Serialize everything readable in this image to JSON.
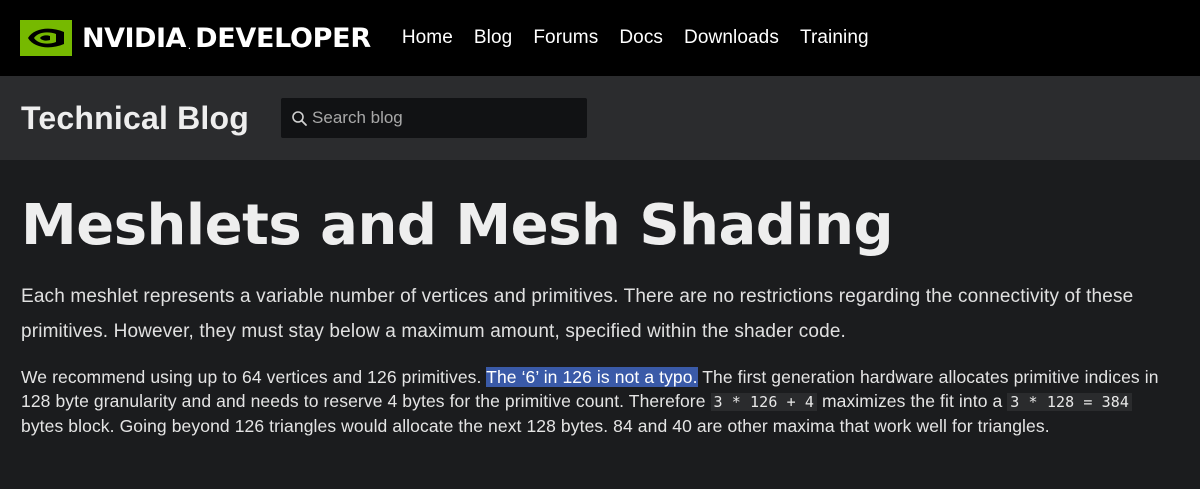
{
  "brand": {
    "logo_icon": "nvidia-eye-logo",
    "name": "NVIDIA",
    "dot": ".",
    "suffix": "DEVELOPER",
    "accent_color": "#76b900"
  },
  "nav": {
    "items": [
      {
        "label": "Home"
      },
      {
        "label": "Blog"
      },
      {
        "label": "Forums"
      },
      {
        "label": "Docs"
      },
      {
        "label": "Downloads"
      },
      {
        "label": "Training"
      }
    ]
  },
  "subheader": {
    "title": "Technical Blog",
    "search": {
      "icon": "search-icon",
      "placeholder": "Search blog",
      "value": ""
    }
  },
  "article": {
    "title": "Meshlets and Mesh Shading",
    "para1": "Each meshlet represents a variable number of vertices and primitives. There are no restrictions regarding the connectivity of these primitives. However, they must stay below a maximum amount, specified within the shader code.",
    "para2": {
      "t1": "We recommend using up to 64 vertices and 126 primitives. ",
      "highlighted": "The ‘6’ in 126 is not a typo.",
      "t2": " The first generation hardware allocates primitive indices in 128 byte granularity and and needs to reserve 4 bytes for the primitive count. Therefore ",
      "code1": "3 * 126 + 4",
      "t3": " maximizes the fit into a ",
      "code2": "3 * 128 = 384",
      "t4": " bytes block. Going beyond 126 triangles would allocate the next 128 bytes. 84 and 40 are other maxima that work well for triangles."
    },
    "highlight_color": "#3a5aa8"
  }
}
